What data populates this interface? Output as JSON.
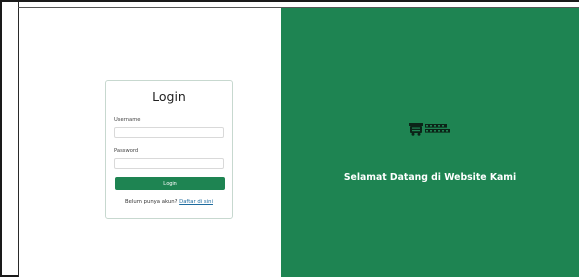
{
  "login": {
    "title": "Login",
    "username_label": "Username",
    "password_label": "Password",
    "button_label": "Login",
    "register_prompt": "Belum punya akun?",
    "register_link": "Daftar di sini"
  },
  "hero": {
    "logo_text": "BUBUR POCADIL",
    "welcome_text": "Selamat Datang di Website Kami"
  },
  "colors": {
    "brand_green": "#1e8452",
    "link_blue": "#1e6b9e"
  }
}
